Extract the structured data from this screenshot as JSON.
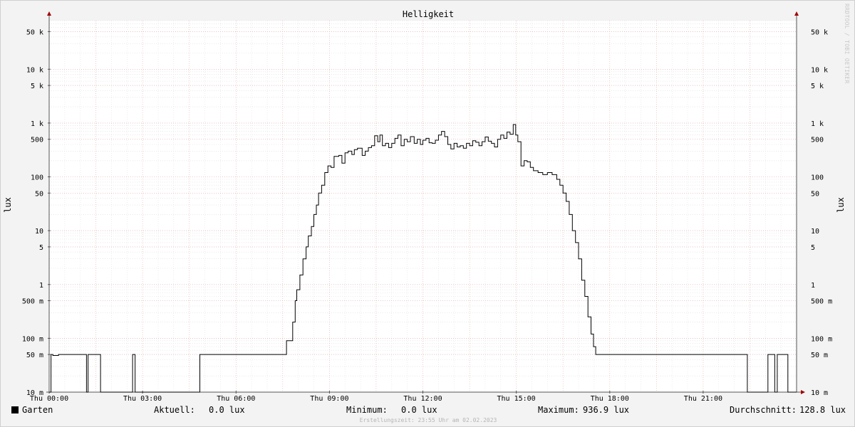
{
  "watermark": "RRDTOOL / TOBI OETIKER",
  "chart_data": {
    "type": "line",
    "title": "Helligkeit",
    "ylabel": "lux",
    "ylabel_right": "lux",
    "y_scale": "log",
    "ylim": [
      0.01,
      80000
    ],
    "xlim": [
      0,
      24
    ],
    "grid": true,
    "y_ticks": [
      {
        "value": 50000,
        "label": "50 k"
      },
      {
        "value": 10000,
        "label": "10 k"
      },
      {
        "value": 5000,
        "label": "5 k"
      },
      {
        "value": 1000,
        "label": "1 k"
      },
      {
        "value": 500,
        "label": "500"
      },
      {
        "value": 100,
        "label": "100"
      },
      {
        "value": 50,
        "label": "50"
      },
      {
        "value": 10,
        "label": "10"
      },
      {
        "value": 5,
        "label": "5"
      },
      {
        "value": 1,
        "label": "1"
      },
      {
        "value": 0.5,
        "label": "500 m"
      },
      {
        "value": 0.1,
        "label": "100 m"
      },
      {
        "value": 0.05,
        "label": "50 m"
      },
      {
        "value": 0.01,
        "label": "10 m"
      }
    ],
    "x_ticks": [
      {
        "value": 0,
        "label": "Thu 00:00"
      },
      {
        "value": 3,
        "label": "Thu 03:00"
      },
      {
        "value": 6,
        "label": "Thu 06:00"
      },
      {
        "value": 9,
        "label": "Thu 09:00"
      },
      {
        "value": 12,
        "label": "Thu 12:00"
      },
      {
        "value": 15,
        "label": "Thu 15:00"
      },
      {
        "value": 18,
        "label": "Thu 18:00"
      },
      {
        "value": 21,
        "label": "Thu 21:00"
      }
    ],
    "series": [
      {
        "name": "Garten",
        "color": "#000000",
        "points": [
          [
            0.0,
            0.01
          ],
          [
            0.05,
            0.01
          ],
          [
            0.06,
            0.05
          ],
          [
            0.12,
            0.048
          ],
          [
            0.3,
            0.05
          ],
          [
            1.2,
            0.01
          ],
          [
            1.25,
            0.05
          ],
          [
            1.6,
            0.05
          ],
          [
            1.65,
            0.01
          ],
          [
            2.65,
            0.01
          ],
          [
            2.68,
            0.05
          ],
          [
            2.73,
            0.05
          ],
          [
            2.76,
            0.01
          ],
          [
            4.8,
            0.01
          ],
          [
            4.84,
            0.05
          ],
          [
            4.95,
            0.05
          ],
          [
            5.05,
            0.05
          ],
          [
            7.55,
            0.05
          ],
          [
            7.62,
            0.09
          ],
          [
            7.75,
            0.09
          ],
          [
            7.82,
            0.2
          ],
          [
            7.9,
            0.5
          ],
          [
            7.95,
            0.8
          ],
          [
            8.05,
            1.5
          ],
          [
            8.15,
            3
          ],
          [
            8.25,
            5
          ],
          [
            8.32,
            8
          ],
          [
            8.42,
            12
          ],
          [
            8.5,
            20
          ],
          [
            8.58,
            30
          ],
          [
            8.65,
            50
          ],
          [
            8.75,
            70
          ],
          [
            8.85,
            120
          ],
          [
            8.95,
            160
          ],
          [
            9.05,
            150
          ],
          [
            9.15,
            240
          ],
          [
            9.3,
            250
          ],
          [
            9.4,
            180
          ],
          [
            9.5,
            280
          ],
          [
            9.6,
            300
          ],
          [
            9.72,
            260
          ],
          [
            9.8,
            320
          ],
          [
            9.9,
            340
          ],
          [
            10.05,
            250
          ],
          [
            10.15,
            300
          ],
          [
            10.25,
            350
          ],
          [
            10.35,
            380
          ],
          [
            10.45,
            580
          ],
          [
            10.55,
            450
          ],
          [
            10.62,
            600
          ],
          [
            10.7,
            380
          ],
          [
            10.8,
            420
          ],
          [
            10.9,
            350
          ],
          [
            11.0,
            420
          ],
          [
            11.1,
            520
          ],
          [
            11.2,
            600
          ],
          [
            11.3,
            380
          ],
          [
            11.4,
            500
          ],
          [
            11.5,
            450
          ],
          [
            11.6,
            560
          ],
          [
            11.72,
            420
          ],
          [
            11.82,
            500
          ],
          [
            11.92,
            400
          ],
          [
            12.0,
            480
          ],
          [
            12.1,
            520
          ],
          [
            12.2,
            430
          ],
          [
            12.3,
            420
          ],
          [
            12.4,
            480
          ],
          [
            12.5,
            600
          ],
          [
            12.6,
            700
          ],
          [
            12.7,
            560
          ],
          [
            12.8,
            400
          ],
          [
            12.9,
            330
          ],
          [
            13.0,
            420
          ],
          [
            13.1,
            360
          ],
          [
            13.2,
            380
          ],
          [
            13.3,
            340
          ],
          [
            13.4,
            420
          ],
          [
            13.5,
            380
          ],
          [
            13.6,
            470
          ],
          [
            13.7,
            440
          ],
          [
            13.8,
            380
          ],
          [
            13.9,
            450
          ],
          [
            14.0,
            550
          ],
          [
            14.1,
            460
          ],
          [
            14.2,
            420
          ],
          [
            14.3,
            360
          ],
          [
            14.4,
            500
          ],
          [
            14.5,
            600
          ],
          [
            14.6,
            520
          ],
          [
            14.7,
            680
          ],
          [
            14.8,
            620
          ],
          [
            14.9,
            937
          ],
          [
            14.98,
            600
          ],
          [
            15.05,
            450
          ],
          [
            15.15,
            160
          ],
          [
            15.25,
            200
          ],
          [
            15.35,
            190
          ],
          [
            15.45,
            150
          ],
          [
            15.55,
            130
          ],
          [
            15.7,
            120
          ],
          [
            15.85,
            110
          ],
          [
            16.0,
            120
          ],
          [
            16.15,
            110
          ],
          [
            16.3,
            90
          ],
          [
            16.4,
            70
          ],
          [
            16.5,
            50
          ],
          [
            16.6,
            35
          ],
          [
            16.7,
            20
          ],
          [
            16.8,
            10
          ],
          [
            16.9,
            6
          ],
          [
            17.0,
            3
          ],
          [
            17.1,
            1.2
          ],
          [
            17.2,
            0.6
          ],
          [
            17.3,
            0.25
          ],
          [
            17.4,
            0.12
          ],
          [
            17.48,
            0.07
          ],
          [
            17.55,
            0.05
          ],
          [
            22.4,
            0.05
          ],
          [
            22.42,
            0.01
          ],
          [
            23.05,
            0.01
          ],
          [
            23.08,
            0.05
          ],
          [
            23.28,
            0.05
          ],
          [
            23.3,
            0.01
          ],
          [
            23.35,
            0.01
          ],
          [
            23.38,
            0.05
          ],
          [
            23.7,
            0.05
          ],
          [
            23.72,
            0.01
          ],
          [
            24.0,
            0.01
          ]
        ]
      }
    ],
    "legend_stats": {
      "current_label": "Aktuell:",
      "current_value": "0.0 lux",
      "min_label": "Minimum:",
      "min_value": "0.0 lux",
      "max_label": "Maximum:",
      "max_value": "936.9 lux",
      "avg_label": "Durchschnitt:",
      "avg_value": "128.8 lux"
    },
    "footer": "Erstellungszeit: 23:55 Uhr am 02.02.2023"
  }
}
